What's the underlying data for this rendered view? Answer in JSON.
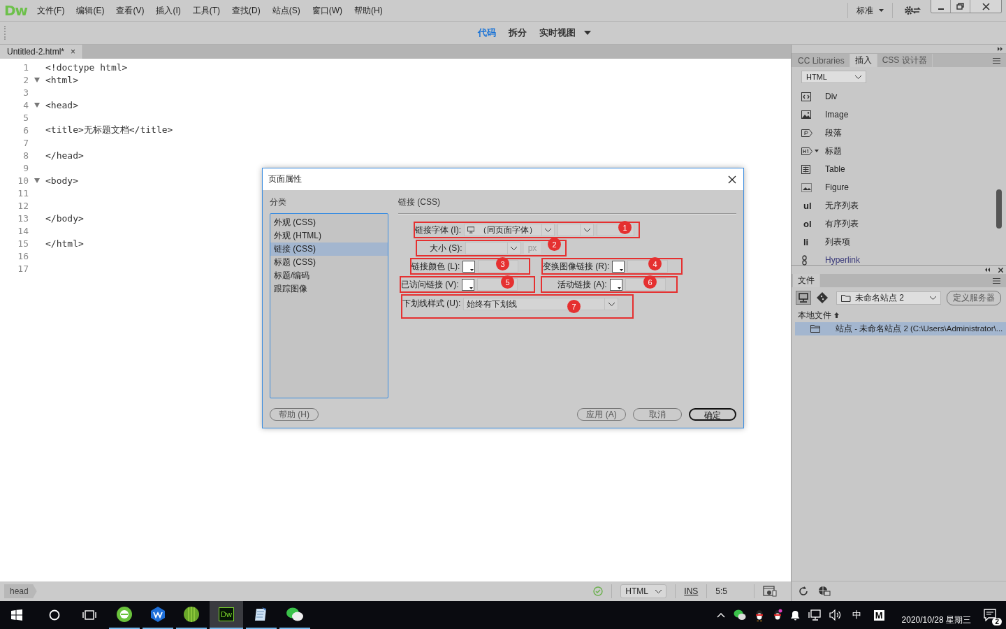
{
  "menubar": {
    "logo": "Dw",
    "menus": [
      "文件(F)",
      "编辑(E)",
      "查看(V)",
      "插入(I)",
      "工具(T)",
      "查找(D)",
      "站点(S)",
      "窗口(W)",
      "帮助(H)"
    ],
    "workspace": "标准"
  },
  "view_bar": {
    "views": [
      {
        "label": "代码",
        "selected": true,
        "dropdown": false
      },
      {
        "label": "拆分",
        "selected": false,
        "dropdown": false
      },
      {
        "label": "实时视图",
        "selected": false,
        "dropdown": true
      }
    ]
  },
  "document_tab": {
    "title": "Untitled-2.html*",
    "close": "×"
  },
  "code": {
    "lines": [
      {
        "number": "1",
        "text": "<!doctype html>",
        "foldable": false
      },
      {
        "number": "2",
        "text": "<html>",
        "foldable": true
      },
      {
        "number": "3",
        "foldable": false
      },
      {
        "number": "4",
        "text": "<head>",
        "foldable": true
      },
      {
        "number": "5",
        "foldable": false
      },
      {
        "number": "6",
        "text": "<title>无标题文档</title>",
        "foldable": false
      },
      {
        "number": "7",
        "foldable": false
      },
      {
        "number": "8",
        "text": "</head>",
        "foldable": false
      },
      {
        "number": "9",
        "foldable": false
      },
      {
        "number": "10",
        "text": "<body>",
        "foldable": true
      },
      {
        "number": "11",
        "foldable": false
      },
      {
        "number": "12",
        "foldable": false
      },
      {
        "number": "13",
        "text": "</body>",
        "foldable": false
      },
      {
        "number": "14",
        "foldable": false
      },
      {
        "number": "15",
        "text": "</html>",
        "foldable": false
      },
      {
        "number": "16",
        "foldable": false
      },
      {
        "number": "17",
        "foldable": false
      }
    ]
  },
  "status_bar": {
    "tag": "head",
    "language": "HTML",
    "insert_mode": "INS",
    "position": "5:5"
  },
  "dialog": {
    "title": "页面属性",
    "category_heading": "分类",
    "categories": [
      {
        "label": "外观 (CSS)",
        "selected": false
      },
      {
        "label": "外观 (HTML)",
        "selected": false
      },
      {
        "label": "链接 (CSS)",
        "selected": true
      },
      {
        "label": "标题 (CSS)",
        "selected": false
      },
      {
        "label": "标题/编码",
        "selected": false
      },
      {
        "label": "跟踪图像",
        "selected": false
      }
    ],
    "section_title": "链接 (CSS)",
    "fields": [
      {
        "kind": "font",
        "label": "链接字体 (I):",
        "value": "（同页面字体）",
        "marker": "1"
      },
      {
        "kind": "size",
        "label": "大小 (S):",
        "unit": "px",
        "marker": "2"
      },
      {
        "kind": "color",
        "label": "链接颜色 (L):",
        "marker": "3"
      },
      {
        "kind": "color",
        "label": "变换图像链接 (R):",
        "marker": "4"
      },
      {
        "kind": "color",
        "label": "已访问链接 (V):",
        "marker": "5"
      },
      {
        "kind": "color",
        "label": "活动链接 (A):",
        "marker": "6"
      },
      {
        "kind": "select",
        "label": "下划线样式 (U):",
        "value": "始终有下划线",
        "marker": "7"
      }
    ],
    "help_button": "帮助 (H)",
    "buttons": [
      {
        "label": "应用 (A)",
        "default": false
      },
      {
        "label": "取消",
        "default": false
      },
      {
        "label": "确定",
        "default": true
      }
    ]
  },
  "panel": {
    "tabs": [
      {
        "label": "CC Libraries",
        "selected": false
      },
      {
        "label": "插入",
        "selected": true
      },
      {
        "label": "CSS 设计器",
        "selected": false
      }
    ],
    "category": "HTML",
    "items": [
      {
        "kind": "div",
        "label": "Div"
      },
      {
        "kind": "image",
        "label": "Image"
      },
      {
        "kind": "paragraph",
        "label": "段落"
      },
      {
        "kind": "heading",
        "label": "标题"
      },
      {
        "kind": "table",
        "label": "Table"
      },
      {
        "kind": "figure",
        "label": "Figure"
      },
      {
        "kind": "text",
        "icon_text": "ul",
        "label": "无序列表"
      },
      {
        "kind": "text",
        "icon_text": "ol",
        "label": "有序列表"
      },
      {
        "kind": "text",
        "icon_text": "li",
        "label": "列表项"
      },
      {
        "kind": "link",
        "label": "Hyperlink"
      }
    ]
  },
  "files": {
    "tab": "文件",
    "site": "未命名站点 2",
    "define_server": "定义服务器",
    "local_heading": "本地文件",
    "rows": [
      {
        "label": "站点 - 未命名站点 2 (C:\\Users\\Administrator\\...",
        "selected": true
      }
    ]
  },
  "taskbar": {
    "apps": [
      {
        "kind": "browser",
        "active": false
      },
      {
        "kind": "wps",
        "active": false
      },
      {
        "kind": "ball",
        "active": false
      },
      {
        "kind": "dw",
        "label": "Dw",
        "active": true
      },
      {
        "kind": "notepad",
        "active": false
      },
      {
        "kind": "wechat",
        "active": false
      }
    ],
    "ime": "中",
    "ime_mode": "M",
    "date": "2020/10/28 星期三",
    "notifications": "2"
  }
}
